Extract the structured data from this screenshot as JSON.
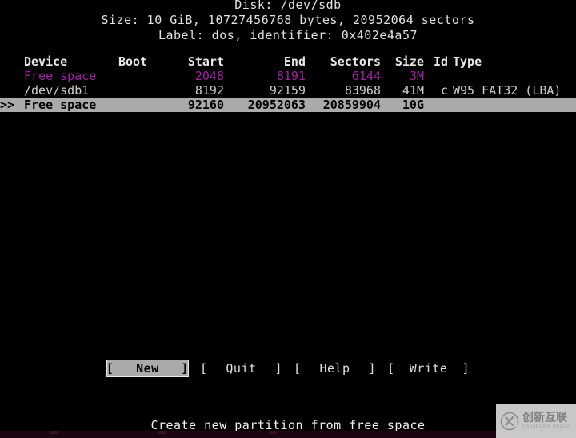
{
  "disk_header": {
    "line_disk": "Disk: /dev/sdb",
    "line_size": "Size: 10 GiB, 10727456768 bytes, 20952064 sectors",
    "line_label": "Label: dos, identifier: 0x402e4a57"
  },
  "table": {
    "columns": {
      "device": "Device",
      "boot": "Boot",
      "start": "Start",
      "end": "End",
      "sectors": "Sectors",
      "size": "Size",
      "id": "Id",
      "type": "Type"
    },
    "rows": [
      {
        "marker": "",
        "device": "Free space",
        "boot": "",
        "start": "2048",
        "end": "8191",
        "sectors": "6144",
        "size": "3M",
        "id": "",
        "type": "",
        "style": "free"
      },
      {
        "marker": "",
        "device": "/dev/sdb1",
        "boot": "",
        "start": "8192",
        "end": "92159",
        "sectors": "83968",
        "size": "41M",
        "id": "c",
        "type": "W95 FAT32 (LBA)",
        "style": "partition"
      },
      {
        "marker": ">>",
        "device": "Free space",
        "boot": "",
        "start": "92160",
        "end": "20952063",
        "sectors": "20859904",
        "size": "10G",
        "id": "",
        "type": "",
        "style": "selected"
      }
    ]
  },
  "buttons": [
    {
      "label": "New",
      "selected": true
    },
    {
      "label": "Quit",
      "selected": false
    },
    {
      "label": "Help",
      "selected": false
    },
    {
      "label": "Write",
      "selected": false
    }
  ],
  "bracket_left": "[",
  "bracket_right": "]",
  "status": "Create new partition from free space",
  "watermark": {
    "cn": "创新互联",
    "en": "CHUANGXIN HULIAN"
  },
  "colors": {
    "background": "#000000",
    "foreground": "#d6d6d6",
    "free_space": "#a020a0",
    "highlight_bg": "#aaaaaa",
    "highlight_fg": "#000000"
  }
}
